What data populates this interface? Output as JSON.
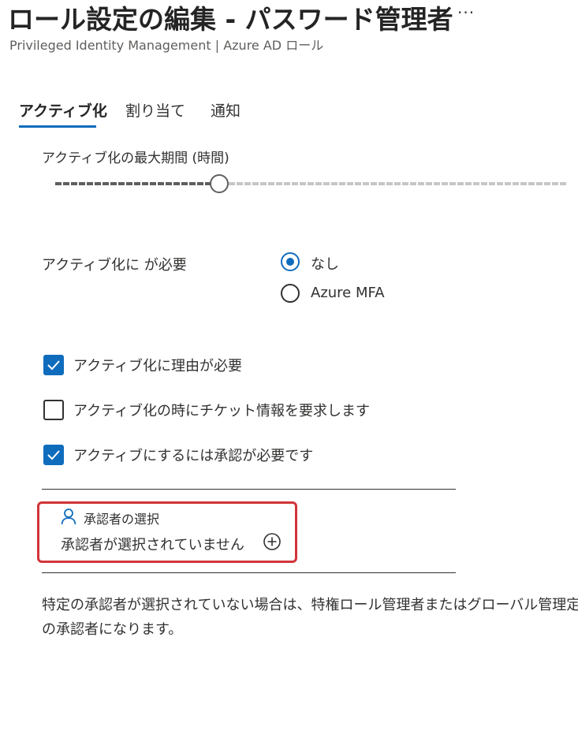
{
  "header": {
    "title": "ロール設定の編集 - パスワード管理者",
    "more_label": "···",
    "subtitle": "Privileged Identity Management | Azure AD ロール"
  },
  "tabs": [
    {
      "label": "アクティブ化",
      "active": true
    },
    {
      "label": "割り当て",
      "active": false
    },
    {
      "label": "通知",
      "active": false
    }
  ],
  "max_duration": {
    "label": "アクティブ化の最大期間 (時間)",
    "slider_fraction": 0.32
  },
  "mfa": {
    "label": "アクティブ化に が必要",
    "options": [
      {
        "label": "なし",
        "selected": true
      },
      {
        "label": "Azure MFA",
        "selected": false
      }
    ]
  },
  "checkboxes": [
    {
      "label": "アクティブ化に理由が必要",
      "checked": true
    },
    {
      "label": "アクティブ化の時にチケット情報を要求します",
      "checked": false
    },
    {
      "label": "アクティブにするには承認が必要です",
      "checked": true
    }
  ],
  "approvers": {
    "heading": "承認者の選択",
    "empty_text": "承認者が選択されていません",
    "person_icon": "person-icon",
    "add_icon": "add-circle-icon"
  },
  "description": "特定の承認者が選択されていない場合は、特権ロール管理者またはグローバル管理定の承認者になります。",
  "colors": {
    "accent": "#0f6cbd",
    "highlight_border": "#d13438",
    "text": "#323130"
  }
}
